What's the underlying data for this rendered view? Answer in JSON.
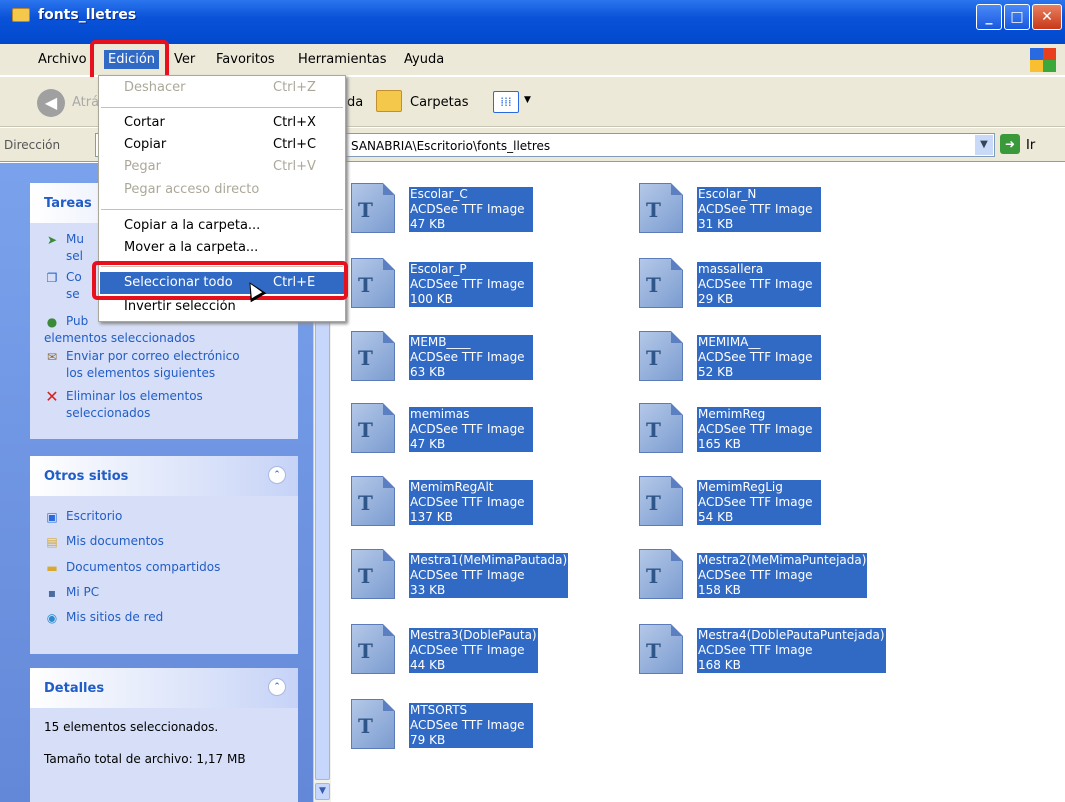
{
  "window": {
    "title": "fonts_lletres"
  },
  "menubar": {
    "items": [
      "Archivo",
      "Edición",
      "Ver",
      "Favoritos",
      "Herramientas",
      "Ayuda"
    ]
  },
  "toolbar": {
    "back": "Atrás",
    "search_fragment": "da",
    "folders": "Carpetas"
  },
  "address": {
    "label": "Dirección",
    "path": "SANABRIA\\Escritorio\\fonts_lletres",
    "go": "Ir"
  },
  "edit_menu": {
    "undo": {
      "label": "Deshacer",
      "shortcut": "Ctrl+Z"
    },
    "cut": {
      "label": "Cortar",
      "shortcut": "Ctrl+X"
    },
    "copy": {
      "label": "Copiar",
      "shortcut": "Ctrl+C"
    },
    "paste": {
      "label": "Pegar",
      "shortcut": "Ctrl+V"
    },
    "paste_shortcut": {
      "label": "Pegar acceso directo"
    },
    "copy_to": {
      "label": "Copiar a la carpeta..."
    },
    "move_to": {
      "label": "Mover a la carpeta..."
    },
    "select_all": {
      "label": "Seleccionar todo",
      "shortcut": "Ctrl+E"
    },
    "invert": {
      "label": "Invertir selección"
    }
  },
  "tasks": {
    "title": "Tareas",
    "items": [
      {
        "l1": "Mu",
        "l2": "sel"
      },
      {
        "l1": "Co",
        "l2": "se"
      },
      {
        "l1": "Pub",
        "l2": "elementos seleccionados"
      },
      {
        "l1": "Enviar por correo electrónico",
        "l2": "los elementos siguientes"
      },
      {
        "l1": "Eliminar los elementos",
        "l2": "seleccionados"
      }
    ]
  },
  "other_places": {
    "title": "Otros sitios",
    "items": [
      "Escritorio",
      "Mis documentos",
      "Documentos compartidos",
      "Mi PC",
      "Mis sitios de red"
    ]
  },
  "details": {
    "title": "Detalles",
    "selected": "15 elementos seleccionados.",
    "size": "Tamaño total de archivo: 1,17 MB"
  },
  "files": [
    {
      "name": "Escolar_C",
      "type": "ACDSee TTF Image",
      "size": "47 KB"
    },
    {
      "name": "Escolar_N",
      "type": "ACDSee TTF Image",
      "size": "31 KB"
    },
    {
      "name": "Escolar_P",
      "type": "ACDSee TTF Image",
      "size": "100 KB"
    },
    {
      "name": "massallera",
      "type": "ACDSee TTF Image",
      "size": "29 KB"
    },
    {
      "name": "MEMB____",
      "type": "ACDSee TTF Image",
      "size": "63 KB"
    },
    {
      "name": "MEMIMA__",
      "type": "ACDSee TTF Image",
      "size": "52 KB"
    },
    {
      "name": "memimas",
      "type": "ACDSee TTF Image",
      "size": "47 KB"
    },
    {
      "name": "MemimReg",
      "type": "ACDSee TTF Image",
      "size": "165 KB"
    },
    {
      "name": "MemimRegAlt",
      "type": "ACDSee TTF Image",
      "size": "137 KB"
    },
    {
      "name": "MemimRegLig",
      "type": "ACDSee TTF Image",
      "size": "54 KB"
    },
    {
      "name": "Mestra1(MeMimaPautada)",
      "type": "ACDSee TTF Image",
      "size": "33 KB"
    },
    {
      "name": "Mestra2(MeMimaPuntejada)",
      "type": "ACDSee TTF Image",
      "size": "158 KB"
    },
    {
      "name": "Mestra3(DoblePauta)",
      "type": "ACDSee TTF Image",
      "size": "44 KB"
    },
    {
      "name": "Mestra4(DoblePautaPuntejada)",
      "type": "ACDSee TTF Image",
      "size": "168 KB"
    },
    {
      "name": "MTSORTS",
      "type": "ACDSee TTF Image",
      "size": "79 KB"
    }
  ],
  "colors": {
    "selection": "#316ac5",
    "highlight_box": "#e8101c",
    "task_text": "#215dc6"
  }
}
